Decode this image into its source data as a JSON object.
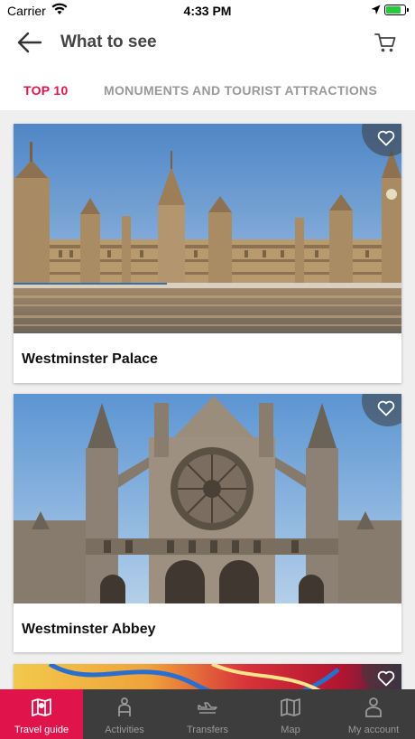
{
  "status_bar": {
    "carrier": "Carrier",
    "time": "4:33 PM",
    "battery_level": 0.85
  },
  "header": {
    "title": "What to see"
  },
  "tabs": [
    {
      "label": "TOP 10",
      "active": true
    },
    {
      "label": "MONUMENTS AND TOURIST ATTRACTIONS",
      "active": false
    }
  ],
  "cards": [
    {
      "name": "Westminster Palace"
    },
    {
      "name": "Westminster Abbey"
    }
  ],
  "tabbar": [
    {
      "label": "Travel guide",
      "icon": "map-icon",
      "active": true
    },
    {
      "label": "Activities",
      "icon": "activities-icon",
      "active": false
    },
    {
      "label": "Transfers",
      "icon": "transfers-icon",
      "active": false
    },
    {
      "label": "Map",
      "icon": "map-icon",
      "active": false
    },
    {
      "label": "My account",
      "icon": "account-icon",
      "active": false
    }
  ],
  "colors": {
    "accent": "#e0144b",
    "tabbar_bg": "#3d3d3d",
    "inactive_tab": "#999999"
  }
}
